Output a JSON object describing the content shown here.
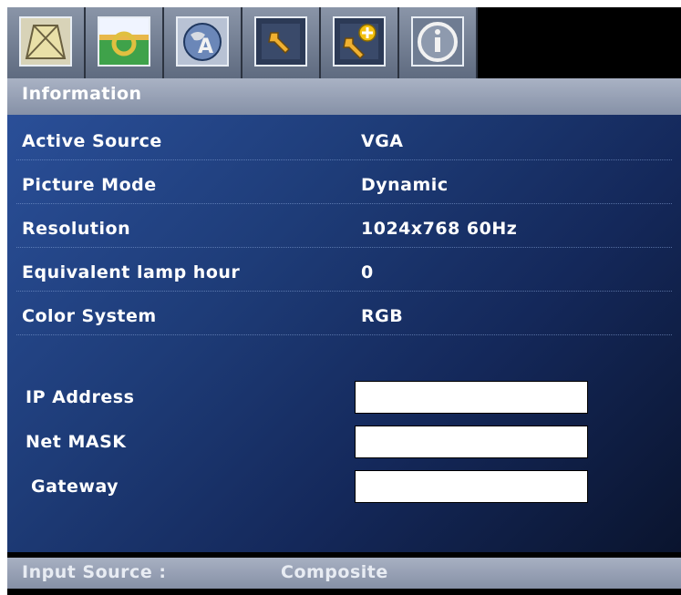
{
  "tabs": [
    {
      "icon": "keystone-icon"
    },
    {
      "icon": "picture-icon"
    },
    {
      "icon": "language-globe-icon"
    },
    {
      "icon": "wrench-icon"
    },
    {
      "icon": "advanced-settings-icon"
    },
    {
      "icon": "info-icon"
    }
  ],
  "header": {
    "title": "Information"
  },
  "info_rows": [
    {
      "label": "Active Source",
      "value": "VGA"
    },
    {
      "label": "Picture Mode",
      "value": "Dynamic"
    },
    {
      "label": "Resolution",
      "value": "1024x768 60Hz"
    },
    {
      "label": "Equivalent lamp hour",
      "value": "0"
    },
    {
      "label": "Color System",
      "value": "RGB"
    }
  ],
  "network": [
    {
      "label": "IP Address",
      "value": ""
    },
    {
      "label": "Net MASK",
      "value": ""
    },
    {
      "label": "Gateway",
      "value": ""
    }
  ],
  "footer": {
    "label": "Input Source :",
    "value": "Composite"
  },
  "colors": {
    "panel_top": "#2a4f98",
    "panel_bottom": "#0a142e",
    "header": "#9aa4b8",
    "text": "#ffffff"
  }
}
